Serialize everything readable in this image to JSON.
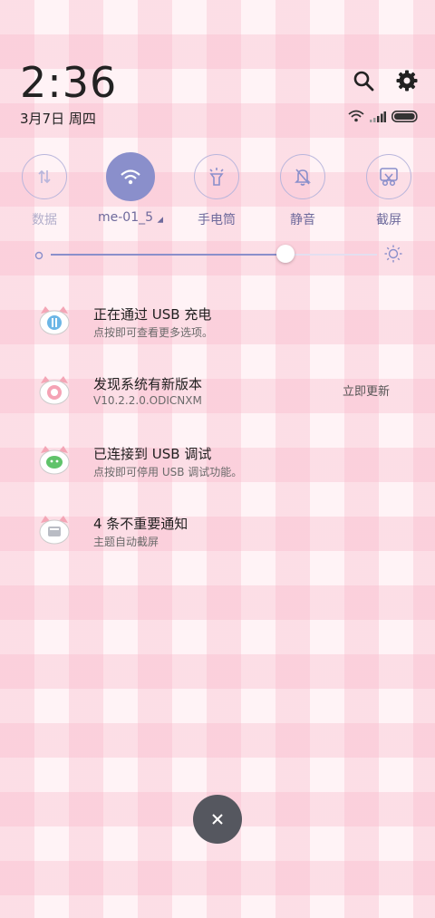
{
  "status": {
    "time": "2:36",
    "date": "3月7日 周四"
  },
  "header_icons": {
    "search": "search-icon",
    "settings": "gear-icon"
  },
  "quick_settings": [
    {
      "label": "数据",
      "icon": "data-arrows-icon",
      "active": false
    },
    {
      "label": "me-01_5",
      "icon": "wifi-icon",
      "active": true
    },
    {
      "label": "手电筒",
      "icon": "flashlight-icon",
      "active": false
    },
    {
      "label": "静音",
      "icon": "mute-bell-icon",
      "active": false
    },
    {
      "label": "截屏",
      "icon": "screenshot-icon",
      "active": false
    }
  ],
  "brightness": {
    "level": 0.72
  },
  "notifications": [
    {
      "title": "正在通过 USB 充电",
      "sub": "点按即可查看更多选项。",
      "action": ""
    },
    {
      "title": "发现系统有新版本",
      "sub": "V10.2.2.0.ODICNXM",
      "action": "立即更新"
    },
    {
      "title": "已连接到 USB 调试",
      "sub": "点按即可停用 USB 调试功能。",
      "action": ""
    },
    {
      "title": "4 条不重要通知",
      "sub": "主题自动截屏",
      "action": ""
    }
  ],
  "colors": {
    "accent": "#8a8fcb",
    "label": "#6e6a9c"
  }
}
